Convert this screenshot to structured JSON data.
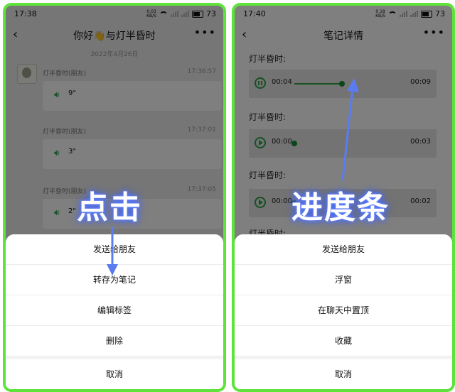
{
  "left": {
    "status": {
      "time": "17:38",
      "speed_top": "0.03",
      "speed_bottom": "KB/S",
      "battery": "73"
    },
    "nav": {
      "title": "你好👋与灯半昏时"
    },
    "chat": {
      "date": "2022年4月26日",
      "messages": [
        {
          "name": "灯半昏时(朋友)",
          "time": "17:36:57",
          "duration": "9\""
        },
        {
          "name": "灯半昏时(朋友)",
          "time": "17:37:01",
          "duration": "3\""
        },
        {
          "name": "灯半昏时(朋友)",
          "time": "17:37:05",
          "duration": "2\""
        }
      ]
    },
    "sheet": {
      "items": [
        "发送给朋友",
        "转存为笔记",
        "编辑标签",
        "删除"
      ],
      "cancel": "取消"
    },
    "overlay": "点击"
  },
  "right": {
    "status": {
      "time": "17:40",
      "speed_top": "0.18",
      "speed_bottom": "KB/S",
      "battery": "73"
    },
    "nav": {
      "title": "笔记详情"
    },
    "notes": [
      {
        "label": "灯半昏时:",
        "current": "00:04",
        "total": "00:09",
        "progress": 0.44,
        "state": "playing"
      },
      {
        "label": "灯半昏时:",
        "current": "00:00",
        "total": "00:03",
        "progress": 0.0,
        "state": "paused"
      },
      {
        "label": "灯半昏时:",
        "current": "00:00",
        "total": "00:02",
        "progress": 0.0,
        "state": "paused"
      }
    ],
    "partial_label": "灯半昏时:",
    "sheet": {
      "items": [
        "发送给朋友",
        "浮窗",
        "在聊天中置顶",
        "收藏"
      ],
      "cancel": "取消"
    },
    "overlay": "进度条"
  },
  "colors": {
    "frame": "#5ee33a",
    "accent": "#2ba245",
    "arrow": "#5b7cf0"
  }
}
